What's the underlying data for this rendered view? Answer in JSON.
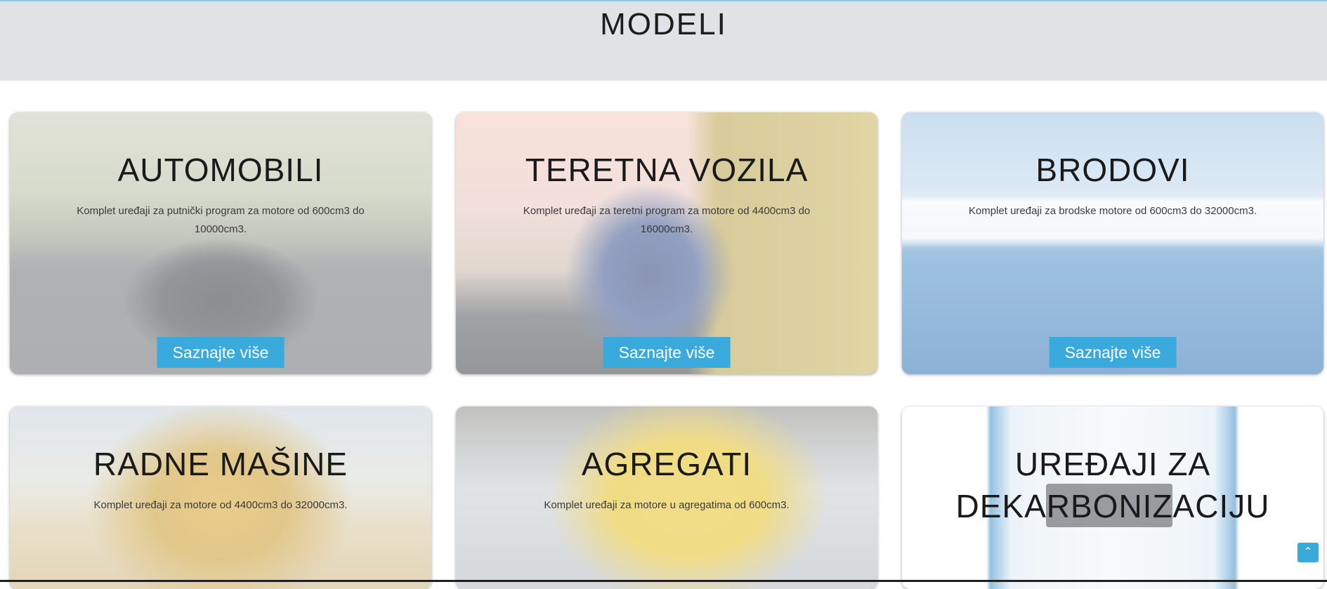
{
  "header": {
    "title": "MODELI"
  },
  "cards": [
    {
      "title": "AUTOMOBILI",
      "description": "Komplet uređaji za putnički program za motore od 600cm3 do 10000cm3.",
      "button": "Saznajte više",
      "image_icon": "car-image"
    },
    {
      "title": "TERETNA VOZILA",
      "description": "Komplet uređaji za teretni program za motore od 4400cm3 do 16000cm3.",
      "button": "Saznajte više",
      "image_icon": "truck-image"
    },
    {
      "title": "BRODOVI",
      "description": "Komplet uređaji za brodske motore od 600cm3 do 32000cm3.",
      "button": "Saznajte više",
      "image_icon": "ship-image"
    },
    {
      "title": "RADNE MAŠINE",
      "description": "Komplet uređaji za motore od 4400cm3 do 32000cm3.",
      "button": "",
      "image_icon": "combine-harvester-image"
    },
    {
      "title": "AGREGATI",
      "description": "Komplet uređaji za motore u agregatima od 600cm3.",
      "button": "",
      "image_icon": "generator-image"
    },
    {
      "title": "UREĐAJI ZA DEKARBONIZACIJU",
      "description": "",
      "button": "",
      "image_icon": "decarbonization-machine-image"
    }
  ],
  "back_to_top": {
    "icon": "chevron-up-icon",
    "glyph": "⌃"
  },
  "colors": {
    "accent": "#3aa9dc",
    "header_bg": "#e1e2e6"
  }
}
